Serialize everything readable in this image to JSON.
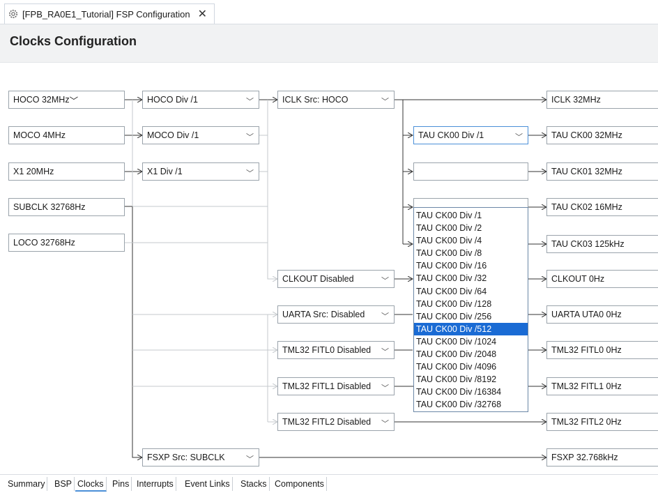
{
  "editor_tab": {
    "title": "[FPB_RA0E1_Tutorial] FSP Configuration",
    "close": "✕"
  },
  "page_title": "Clocks Configuration",
  "sources": [
    "HOCO 32MHz",
    "MOCO 4MHz",
    "X1 20MHz",
    "SUBCLK 32768Hz",
    "LOCO 32768Hz"
  ],
  "dividers": [
    "HOCO Div /1",
    "MOCO Div /1",
    "X1 Div /1"
  ],
  "selectors": {
    "iclk": "ICLK Src: HOCO",
    "clkout": "CLKOUT Disabled",
    "uarta": "UARTA Src: Disabled",
    "fitl0": "TML32 FITL0 Disabled",
    "fitl1": "TML32 FITL1 Disabled",
    "fitl2": "TML32 FITL2 Disabled",
    "fsxp": "FSXP Src: SUBCLK"
  },
  "tau_dropdown": {
    "value": "TAU CK00 Div /1",
    "options": [
      "TAU CK00 Div /1",
      "TAU CK00 Div /2",
      "TAU CK00 Div /4",
      "TAU CK00 Div /8",
      "TAU CK00 Div /16",
      "TAU CK00 Div /32",
      "TAU CK00 Div /64",
      "TAU CK00 Div /128",
      "TAU CK00 Div /256",
      "TAU CK00 Div /512",
      "TAU CK00 Div /1024",
      "TAU CK00 Div /2048",
      "TAU CK00 Div /4096",
      "TAU CK00 Div /8192",
      "TAU CK00 Div /16384",
      "TAU CK00 Div /32768"
    ],
    "highlighted": "TAU CK00 Div /512"
  },
  "outputs": {
    "iclk": "ICLK 32MHz",
    "ck00": "TAU CK00 32MHz",
    "ck01": "TAU CK01 32MHz",
    "ck02": "TAU CK02 16MHz",
    "ck03": "TAU CK03 125kHz",
    "clkout": "CLKOUT 0Hz",
    "uarta": "UARTA UTA0 0Hz",
    "fitl0": "TML32 FITL0 0Hz",
    "fitl1": "TML32 FITL1 0Hz",
    "fitl2": "TML32 FITL2 0Hz",
    "fsxp": "FSXP 32.768kHz"
  },
  "bottom_tabs": [
    "Summary",
    "BSP",
    "Clocks",
    "Pins",
    "Interrupts",
    "Event Links",
    "Stacks",
    "Components"
  ],
  "active_bottom_tab": "Clocks",
  "icons": {
    "editor": "gear-icon",
    "dropdown": "chevron-down-icon",
    "close": "close-icon"
  },
  "colors": {
    "selection": "#1a6bd4",
    "active_border": "#4a8fd8",
    "header_bg": "#f1f2f3"
  }
}
